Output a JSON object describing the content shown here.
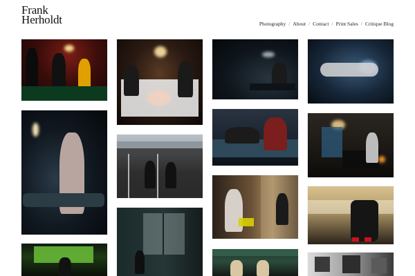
{
  "brand": {
    "line1": "Frank",
    "line2": "Herholdt"
  },
  "nav": {
    "items": [
      {
        "label": "Photography"
      },
      {
        "label": "About"
      },
      {
        "label": "Contact"
      },
      {
        "label": "Print Sales"
      },
      {
        "label": "Critique Blog"
      }
    ],
    "separator": "/"
  }
}
